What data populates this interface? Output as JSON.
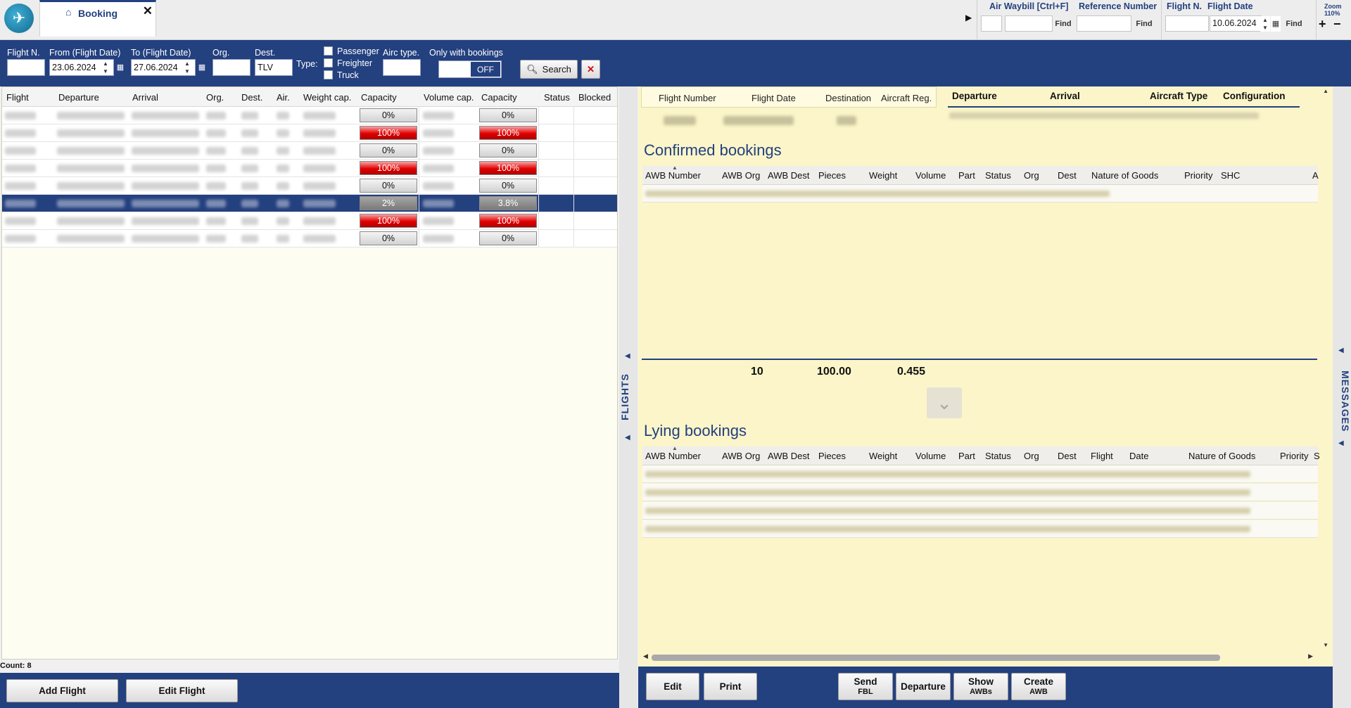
{
  "tab": {
    "label": "Booking",
    "close": "✕"
  },
  "top_search": {
    "awb_label": "Air Waybill [Ctrl+F]",
    "ref_label": "Reference Number",
    "flight_n_label": "Flight N.",
    "flight_date_label": "Flight Date",
    "flight_date_value": "10.06.2024",
    "find": "Find",
    "zoom_label": "Zoom",
    "zoom_value": "110%",
    "zoom_in": "+",
    "zoom_out": "−"
  },
  "filters": {
    "flight_n": "Flight N.",
    "from_label": "From (Flight Date)",
    "from_value": "23.06.2024",
    "to_label": "To (Flight Date)",
    "to_value": "27.06.2024",
    "org": "Org.",
    "dest": "Dest.",
    "dest_value": "TLV",
    "type": "Type:",
    "passenger": "Passenger",
    "freighter": "Freighter",
    "truck": "Truck",
    "airc_type": "Airc type.",
    "only_with_bookings": "Only with bookings",
    "toggle": "OFF",
    "search": "Search",
    "clear": "✕"
  },
  "flights_table": {
    "headers": [
      "Flight",
      "Departure",
      "Arrival",
      "Org.",
      "Dest.",
      "Air.",
      "Weight cap.",
      "Capacity",
      "Volume cap.",
      "Capacity",
      "Status",
      "Blocked"
    ],
    "rows": [
      {
        "wcap": "0%",
        "vcap": "0%",
        "state": "normal"
      },
      {
        "wcap": "100%",
        "vcap": "100%",
        "state": "full"
      },
      {
        "wcap": "0%",
        "vcap": "0%",
        "state": "normal"
      },
      {
        "wcap": "100%",
        "vcap": "100%",
        "state": "full"
      },
      {
        "wcap": "0%",
        "vcap": "0%",
        "state": "normal"
      },
      {
        "wcap": "2%",
        "vcap": "3.8%",
        "state": "selected"
      },
      {
        "wcap": "100%",
        "vcap": "100%",
        "state": "full"
      },
      {
        "wcap": "0%",
        "vcap": "0%",
        "state": "normal"
      }
    ],
    "count": "Count: 8"
  },
  "left_footer": {
    "add": "Add Flight",
    "edit": "Edit Flight"
  },
  "side_labels": {
    "flights": "FLIGHTS",
    "messages": "MESSAGES"
  },
  "detail": {
    "tabs": [
      "Flight Number",
      "Flight Date",
      "Destination",
      "Aircraft Reg."
    ],
    "headers2": [
      "Departure",
      "Arrival",
      "Aircraft Type",
      "Configuration"
    ],
    "confirmed_title": "Confirmed bookings",
    "confirmed_headers": [
      "AWB Number",
      "AWB Org",
      "AWB Dest",
      "Pieces",
      "Weight",
      "Volume",
      "Part",
      "Status",
      "Org",
      "Dest",
      "Nature of Goods",
      "Priority",
      "SHC",
      "A"
    ],
    "totals": {
      "pieces": "10",
      "weight": "100.00",
      "volume": "0.455"
    },
    "lying_title": "Lying bookings",
    "lying_headers": [
      "AWB Number",
      "AWB Org",
      "AWB Dest",
      "Pieces",
      "Weight",
      "Volume",
      "Part",
      "Status",
      "Org",
      "Dest",
      "Flight",
      "Date",
      "Nature of Goods",
      "Priority",
      "S"
    ]
  },
  "right_footer": {
    "edit": "Edit",
    "print": "Print",
    "send_fbl_1": "Send",
    "send_fbl_2": "FBL",
    "departure": "Departure",
    "show_awbs_1": "Show",
    "show_awbs_2": "AWBs",
    "create_awb_1": "Create",
    "create_awb_2": "AWB"
  }
}
